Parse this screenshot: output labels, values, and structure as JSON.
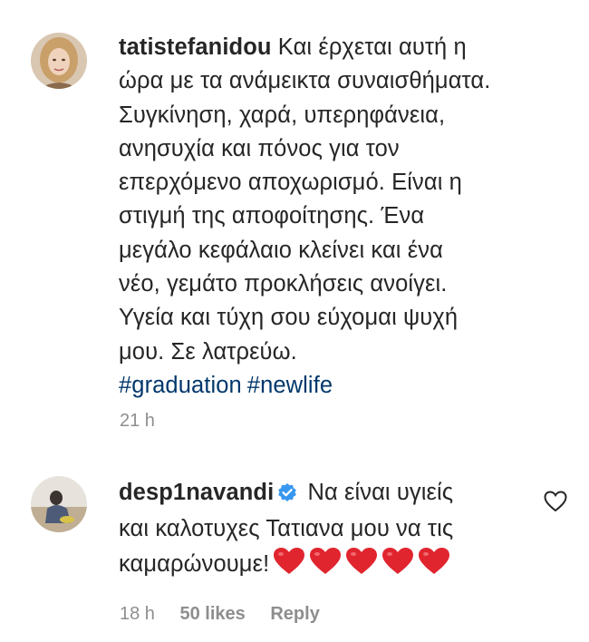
{
  "comments": [
    {
      "username": "tatistefanidou",
      "lines": [
        "Και έρχεται αυτή η",
        "ώρα με τα ανάμεικτα συναισθήματα.",
        "Συγκίνηση, χαρά, υπερηφάνεια,",
        "ανησυχία και πόνος για τον",
        "επερχόμενο αποχωρισμό. Είναι η",
        "στιγμή της αποφοίτησης. Ένα",
        "μεγάλο κεφάλαιο κλείνει και ένα",
        "νέο, γεμάτο προκλήσεις ανοίγει.",
        "Υγεία και τύχη σου εύχομαι ψυχή",
        "μου. Σε λατρεύω."
      ],
      "hashtags": [
        "#graduation",
        "#newlife"
      ],
      "time": "21 h"
    },
    {
      "username": "desp1navandi",
      "verified": true,
      "lines": [
        "Να είναι υγιείς",
        "και καλοτυχες Τατιανα μου να τις",
        "καμαρώνουμε!"
      ],
      "heart_emoji_count": 5,
      "time": "18 h",
      "likes": "50 likes",
      "reply": "Reply"
    }
  ],
  "colors": {
    "text": "#262626",
    "muted": "#8e8e8e",
    "hashtag": "#00376b",
    "verified": "#3897f0",
    "heart_emoji": "#e0252f"
  },
  "icons": [
    "verified-badge-icon",
    "heart-outline-icon",
    "red-heart-emoji-icon"
  ]
}
